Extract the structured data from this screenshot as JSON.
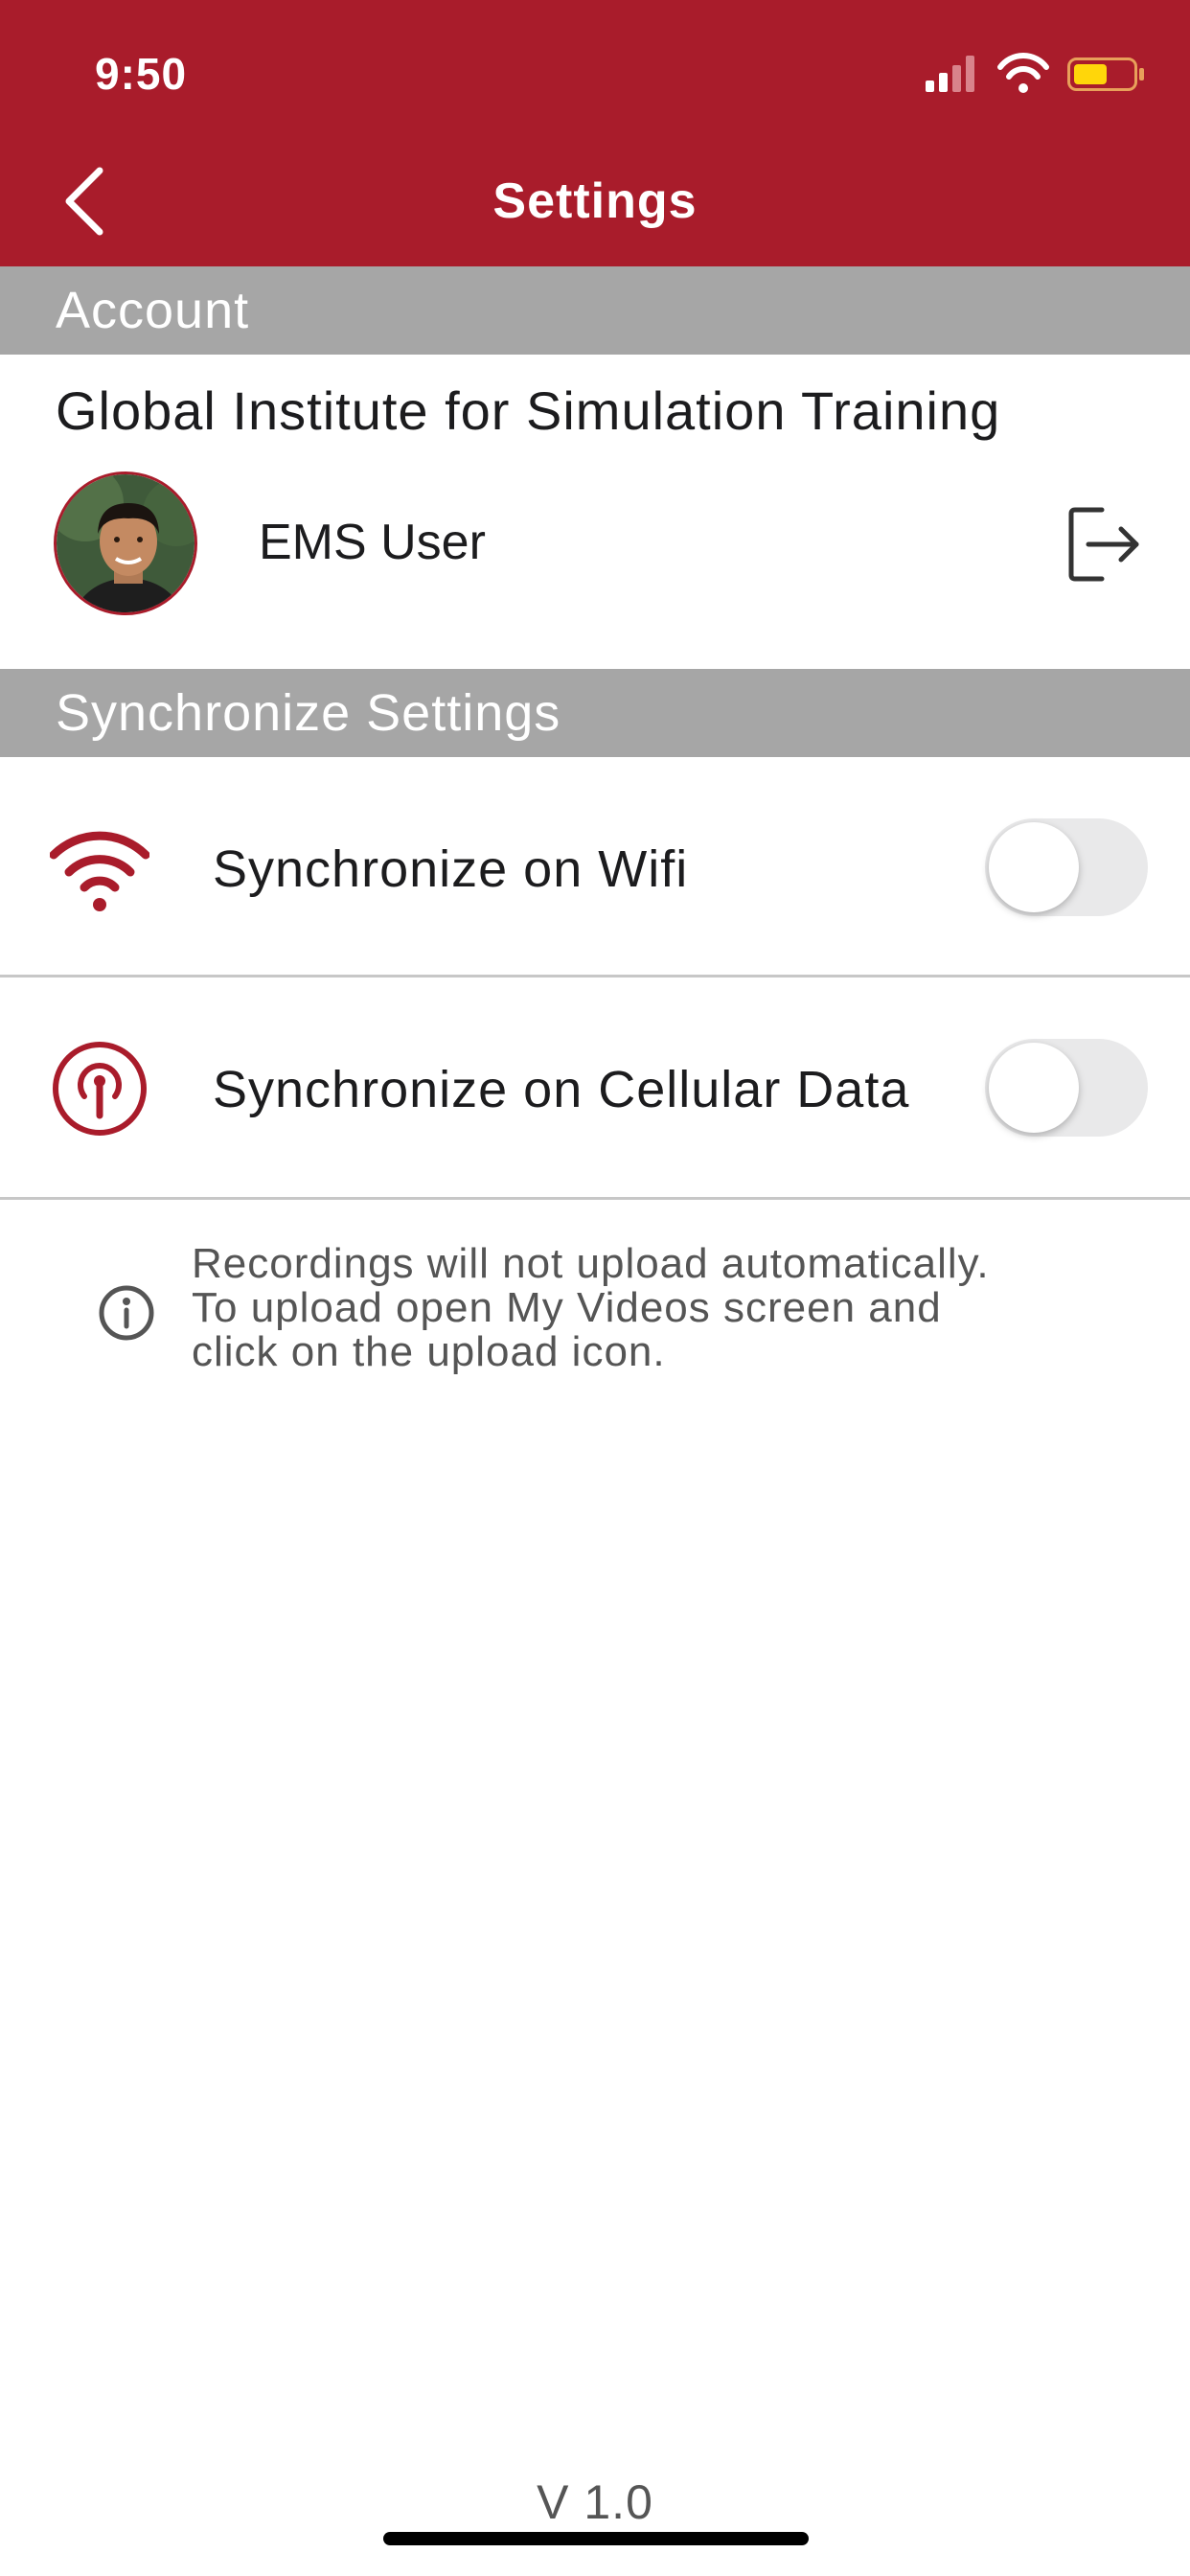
{
  "status_bar": {
    "time": "9:50"
  },
  "nav": {
    "title": "Settings",
    "back_icon": "chevron-left-icon"
  },
  "account": {
    "section_title": "Account",
    "organization": "Global Institute for Simulation Training",
    "user_name": "EMS User",
    "logout_icon": "logout-icon"
  },
  "sync": {
    "section_title": "Synchronize Settings",
    "rows": [
      {
        "label": "Synchronize on Wifi",
        "icon": "wifi-icon",
        "enabled": false
      },
      {
        "label": "Synchronize on Cellular Data",
        "icon": "cellular-antenna-icon",
        "enabled": false
      }
    ],
    "info_lines": [
      "Recordings will not upload automatically.",
      "To upload open My Videos screen and",
      "click on the upload icon."
    ]
  },
  "footer": {
    "version": "V 1.0"
  },
  "colors": {
    "brand": "#a91c2b",
    "section_header_bg": "#a6a6a6",
    "toggle_off": "#e9e9ea"
  }
}
